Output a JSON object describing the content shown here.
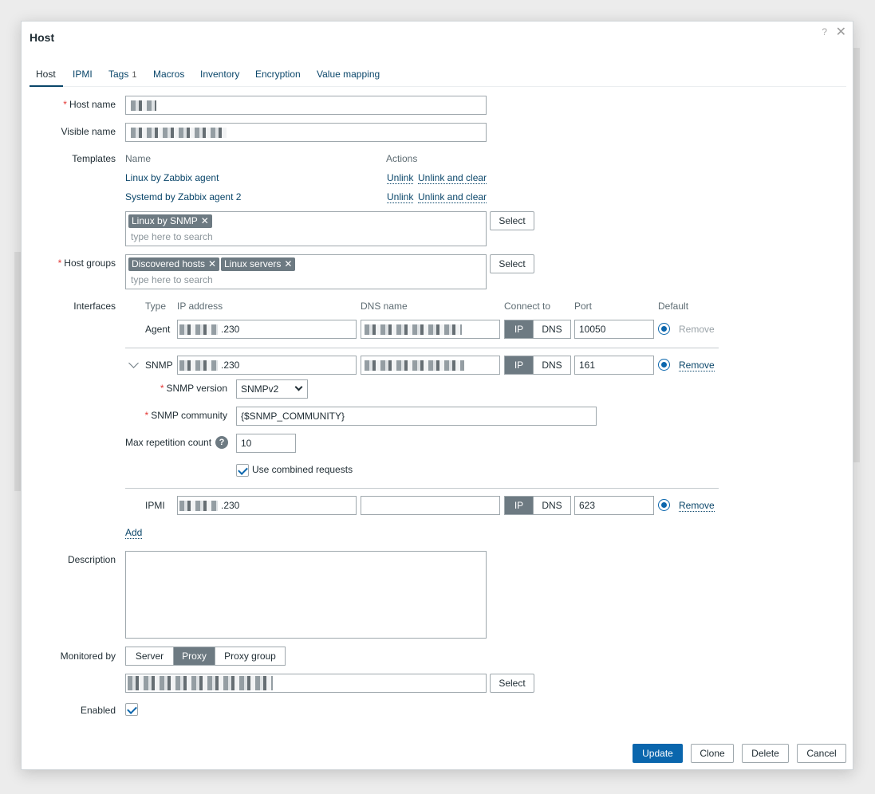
{
  "dialog": {
    "title": "Host",
    "help_icon": "question-icon",
    "close_icon": "close-icon"
  },
  "tabs": [
    {
      "label": "Host",
      "active": true
    },
    {
      "label": "IPMI"
    },
    {
      "label": "Tags",
      "count": "1"
    },
    {
      "label": "Macros"
    },
    {
      "label": "Inventory"
    },
    {
      "label": "Encryption"
    },
    {
      "label": "Value mapping"
    }
  ],
  "form": {
    "host_name_label": "Host name",
    "visible_name_label": "Visible name",
    "templates_label": "Templates",
    "templates_col_name": "Name",
    "templates_col_actions": "Actions",
    "templates": [
      {
        "name": "Linux by Zabbix agent",
        "unlink": "Unlink",
        "unlink_clear": "Unlink and clear"
      },
      {
        "name": "Systemd by Zabbix agent 2",
        "unlink": "Unlink",
        "unlink_clear": "Unlink and clear"
      }
    ],
    "template_chips": [
      "Linux by SNMP"
    ],
    "search_placeholder": "type here to search",
    "select_label": "Select",
    "host_groups_label": "Host groups",
    "host_group_chips": [
      "Discovered hosts",
      "Linux servers"
    ],
    "interfaces_label": "Interfaces",
    "iface_headers": {
      "type": "Type",
      "ip": "IP address",
      "dns": "DNS name",
      "connect": "Connect to",
      "port": "Port",
      "default": "Default"
    },
    "interfaces": [
      {
        "type": "Agent",
        "ip_suffix": ".230",
        "ip_btn": "IP",
        "dns_btn": "DNS",
        "port": "10050",
        "remove": "Remove"
      },
      {
        "type": "SNMP",
        "ip_suffix": ".230",
        "ip_btn": "IP",
        "dns_btn": "DNS",
        "port": "161",
        "remove": "Remove"
      },
      {
        "type": "IPMI",
        "ip_suffix": ".230",
        "ip_btn": "IP",
        "dns_btn": "DNS",
        "port": "623",
        "remove": "Remove"
      }
    ],
    "snmp_version_label": "SNMP version",
    "snmp_version_value": "SNMPv2",
    "snmp_community_label": "SNMP community",
    "snmp_community_value": "{$SNMP_COMMUNITY}",
    "max_rep_label": "Max repetition count",
    "max_rep_value": "10",
    "combined_label": "Use combined requests",
    "add_label": "Add",
    "description_label": "Description",
    "monitored_by_label": "Monitored by",
    "monitored_options": [
      "Server",
      "Proxy",
      "Proxy group"
    ],
    "enabled_label": "Enabled"
  },
  "footer": {
    "update": "Update",
    "clone": "Clone",
    "delete": "Delete",
    "cancel": "Cancel"
  },
  "colors": {
    "link": "#0a466a",
    "primary": "#0a66ad",
    "required": "#e33734",
    "chip": "#6d7a82"
  }
}
